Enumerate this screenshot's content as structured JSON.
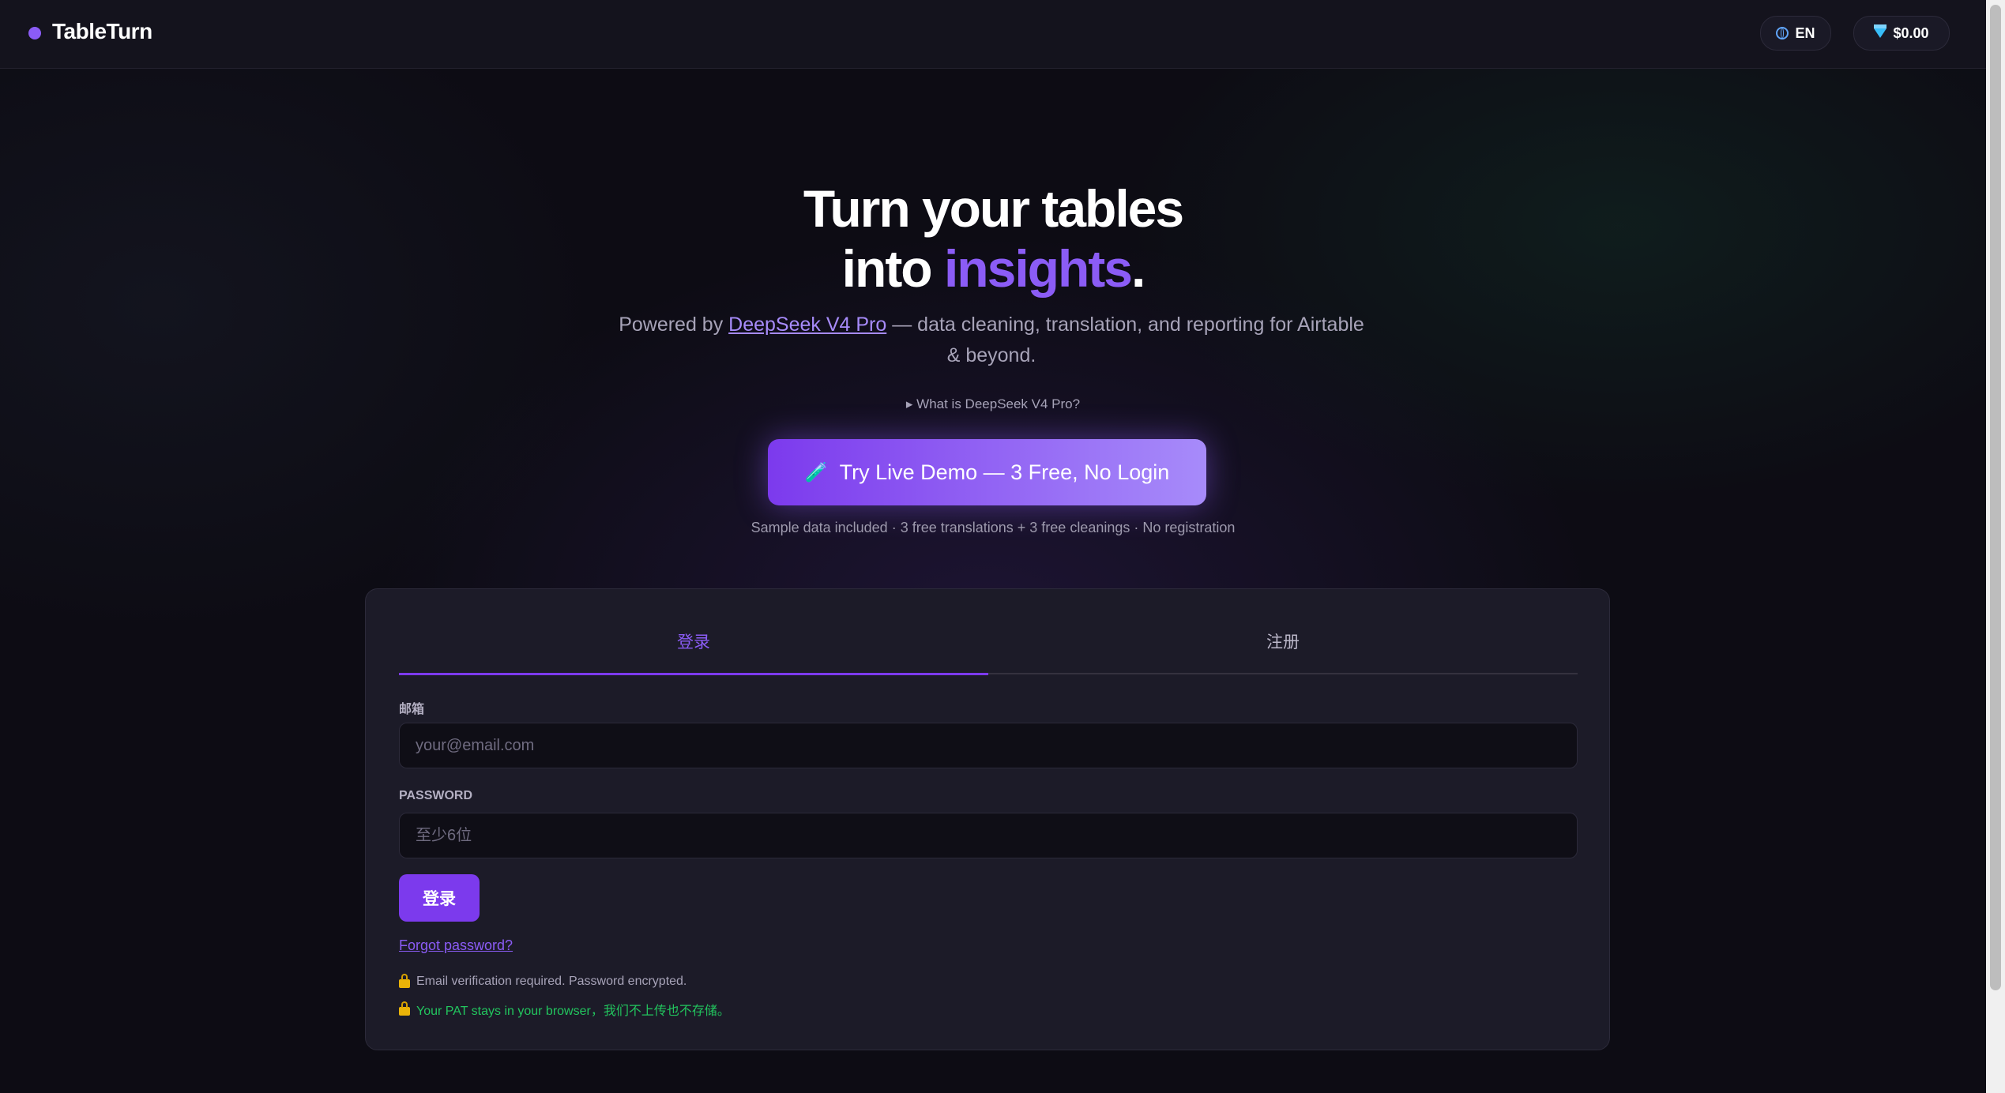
{
  "header": {
    "brand": "TableTurn",
    "language": "EN",
    "balance": "$0.00"
  },
  "hero": {
    "title_line1": "Turn your tables",
    "title_line2_prefix": "into ",
    "title_line2_accent": "insights",
    "title_line2_suffix": ".",
    "subtitle_prefix": "Powered by ",
    "subtitle_link": "DeepSeek V4 Pro",
    "subtitle_suffix": " — data cleaning, translation, and reporting for Airtable & beyond.",
    "what_is": "▸ What is DeepSeek V4 Pro?",
    "cta_icon": "🧪",
    "cta_label": "Try Live Demo — 3 Free, No Login",
    "sample_note": "Sample data included · 3 free translations + 3 free cleanings · No registration"
  },
  "auth": {
    "tab_login": "登录",
    "tab_register": "注册",
    "email_label": "邮箱",
    "email_placeholder": "your@email.com",
    "password_label": "PASSWORD",
    "password_placeholder": "至少6位",
    "submit_label": "登录",
    "forgot_link": "Forgot password?",
    "note_email": "Email verification required. Password encrypted.",
    "note_pat": "Your PAT stays in your browser，我们不上传也不存储。"
  },
  "colors": {
    "accent": "#8b5cf6",
    "button": "#7c3aed",
    "success_text": "#22c55e",
    "background": "#0d0c14"
  },
  "icons": [
    "brand-dot-icon",
    "globe-icon",
    "gem-icon",
    "test-tube-icon",
    "lock-icon"
  ]
}
